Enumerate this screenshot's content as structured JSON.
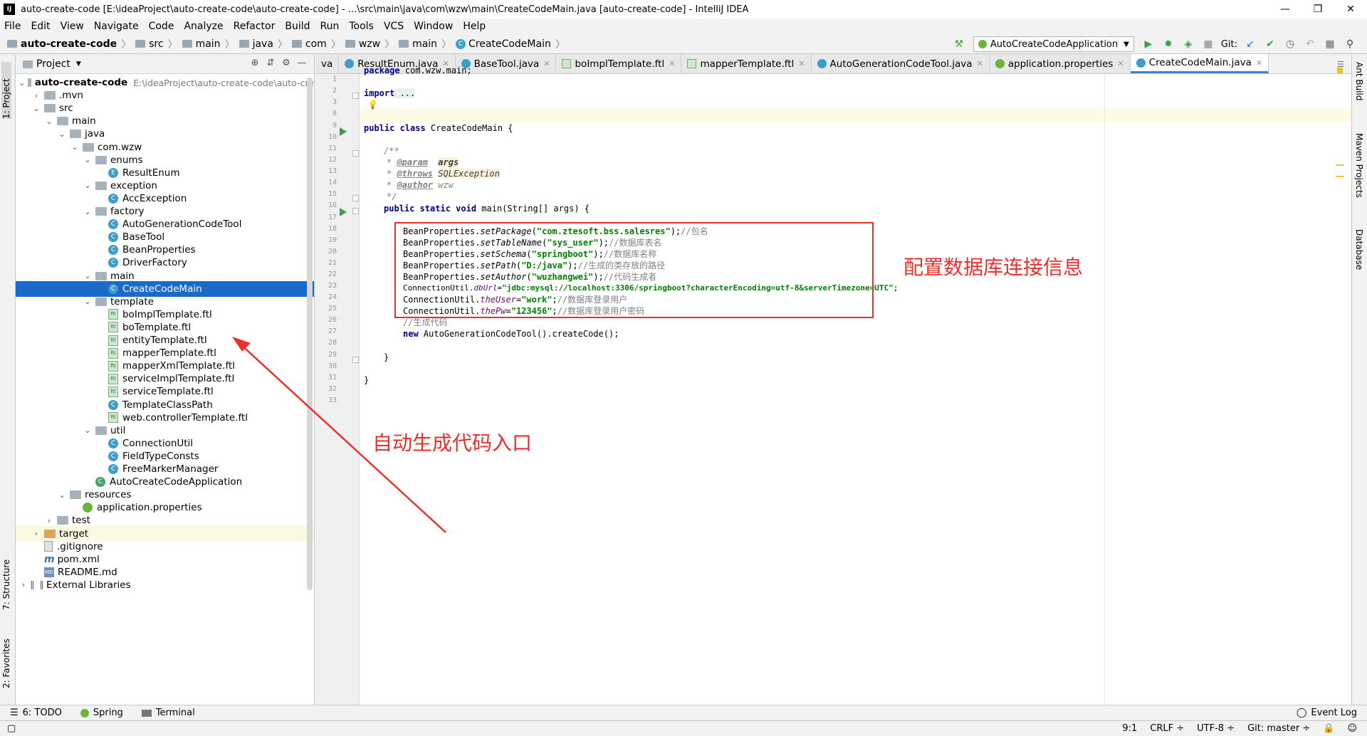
{
  "window": {
    "title": "auto-create-code [E:\\ideaProject\\auto-create-code\\auto-create-code] - ...\\src\\main\\java\\com\\wzw\\main\\CreateCodeMain.java [auto-create-code] - IntelliJ IDEA",
    "minimize": "—",
    "maximize": "❐",
    "close": "✕"
  },
  "menu": [
    "File",
    "Edit",
    "View",
    "Navigate",
    "Code",
    "Analyze",
    "Refactor",
    "Build",
    "Run",
    "Tools",
    "VCS",
    "Window",
    "Help"
  ],
  "breadcrumbs": [
    "auto-create-code",
    "src",
    "main",
    "java",
    "com",
    "wzw",
    "main",
    "CreateCodeMain"
  ],
  "toolbar": {
    "run_config": "AutoCreateCodeApplication",
    "git_label": "Git:"
  },
  "left_strip": {
    "project": "1: Project",
    "structure": "7: Structure",
    "favorites": "2: Favorites"
  },
  "right_strip": {
    "ant": "Ant Build",
    "maven": "Maven Projects",
    "database": "Database"
  },
  "project_panel": {
    "title": "Project",
    "root_name": "auto-create-code",
    "root_path": "E:\\ideaProject\\auto-create-code\\auto-cre",
    "items": [
      {
        "label": ".mvn"
      },
      {
        "label": "src"
      },
      {
        "label": "main"
      },
      {
        "label": "java"
      },
      {
        "label": "com.wzw"
      },
      {
        "label": "enums"
      },
      {
        "label": "ResultEnum"
      },
      {
        "label": "exception"
      },
      {
        "label": "AccException"
      },
      {
        "label": "factory"
      },
      {
        "label": "AutoGenerationCodeTool"
      },
      {
        "label": "BaseTool"
      },
      {
        "label": "BeanProperties"
      },
      {
        "label": "DriverFactory"
      },
      {
        "label": "main"
      },
      {
        "label": "CreateCodeMain"
      },
      {
        "label": "template"
      },
      {
        "label": "boImplTemplate.ftl"
      },
      {
        "label": "boTemplate.ftl"
      },
      {
        "label": "entityTemplate.ftl"
      },
      {
        "label": "mapperTemplate.ftl"
      },
      {
        "label": "mapperXmlTemplate.ftl"
      },
      {
        "label": "serviceImplTemplate.ftl"
      },
      {
        "label": "serviceTemplate.ftl"
      },
      {
        "label": "TemplateClassPath"
      },
      {
        "label": "web.controllerTemplate.ftl"
      },
      {
        "label": "util"
      },
      {
        "label": "ConnectionUtil"
      },
      {
        "label": "FieldTypeConsts"
      },
      {
        "label": "FreeMarkerManager"
      },
      {
        "label": "AutoCreateCodeApplication"
      },
      {
        "label": "resources"
      },
      {
        "label": "application.properties"
      },
      {
        "label": "test"
      },
      {
        "label": "target"
      },
      {
        "label": ".gitignore"
      },
      {
        "label": "pom.xml"
      },
      {
        "label": "README.md"
      },
      {
        "label": "External Libraries"
      }
    ]
  },
  "tabs": [
    {
      "label": "va"
    },
    {
      "label": "ResultEnum.java"
    },
    {
      "label": "BaseTool.java"
    },
    {
      "label": "boImplTemplate.ftl"
    },
    {
      "label": "mapperTemplate.ftl"
    },
    {
      "label": "AutoGenerationCodeTool.java"
    },
    {
      "label": "application.properties"
    },
    {
      "label": "CreateCodeMain.java"
    }
  ],
  "gutter": [
    "1",
    "2",
    "3",
    "8",
    "9",
    "10",
    "11",
    "12",
    "13",
    "14",
    "15",
    "16",
    "17",
    "18",
    "19",
    "20",
    "21",
    "22",
    "23",
    "24",
    "25",
    "26",
    "27",
    "28",
    "29",
    "30",
    "31",
    "32",
    "33"
  ],
  "code": {
    "package_kw": "package",
    "package_name": " com.wzw.main;",
    "import_kw": "import",
    "import_dots": " ...",
    "class_decl_kw": "public class",
    "class_decl_name": " CreateCodeMain {",
    "javadoc_open": "/**",
    "param_tag": "@param",
    "param_name": "args",
    "throws_tag": "@throws",
    "throws_name": "SQLException",
    "author_tag": "@author",
    "author_name": " wzw",
    "javadoc_close": "*/",
    "main_kw": "public static void",
    "main_sig": " main(String[] args) {",
    "l19_a": "BeanProperties.",
    "l19_m": "setPackage",
    "l19_s": "\"com.ztesoft.bss.salesres\"",
    "l19_c": "//包名",
    "l20_m": "setTableName",
    "l20_s": "\"sys_user\"",
    "l20_c": "//数据库表名",
    "l21_m": "setSchema",
    "l21_s": "\"springboot\"",
    "l21_c": "//数据库名称",
    "l22_m": "setPath",
    "l22_s": "\"D:/java\"",
    "l22_c": "//生成的类存放的路径",
    "l23_m": "setAuthor",
    "l23_s": "\"wuzhangwei\"",
    "l23_c": "//代码生成者",
    "cu": "ConnectionUtil.",
    "l24_f": "dbUrl",
    "l24_s": "\"jdbc:mysql://localhost:3306/springboot?characterEncoding=utf-8&serverTimezone=UTC\"",
    "l25_f": "theUser",
    "l25_s": "\"work\"",
    "l25_c": "//数据库登录用户",
    "l26_f": "thePw",
    "l26_s": "\"123456\"",
    "l26_c": "//数据库登录用户密码",
    "l27_c": "//生成代码",
    "l28_kw": "new",
    "l28_rest": " AutoGenerationCodeTool().createCode();",
    "close_brace": "}"
  },
  "annotations": {
    "config_note": "配置数据库连接信息",
    "entry_note": "自动生成代码入口",
    "color": "#e8302d"
  },
  "bottom_tools": [
    "6: TODO",
    "Spring",
    "Terminal",
    "Event Log"
  ],
  "status": {
    "position": "9:1",
    "line_sep": "CRLF ÷",
    "encoding": "UTF-8 ÷",
    "git": "Git: master ÷"
  },
  "colors": {
    "selection": "#1b6ac9",
    "keyword": "#000080",
    "string": "#008000",
    "field": "#660e7a"
  }
}
